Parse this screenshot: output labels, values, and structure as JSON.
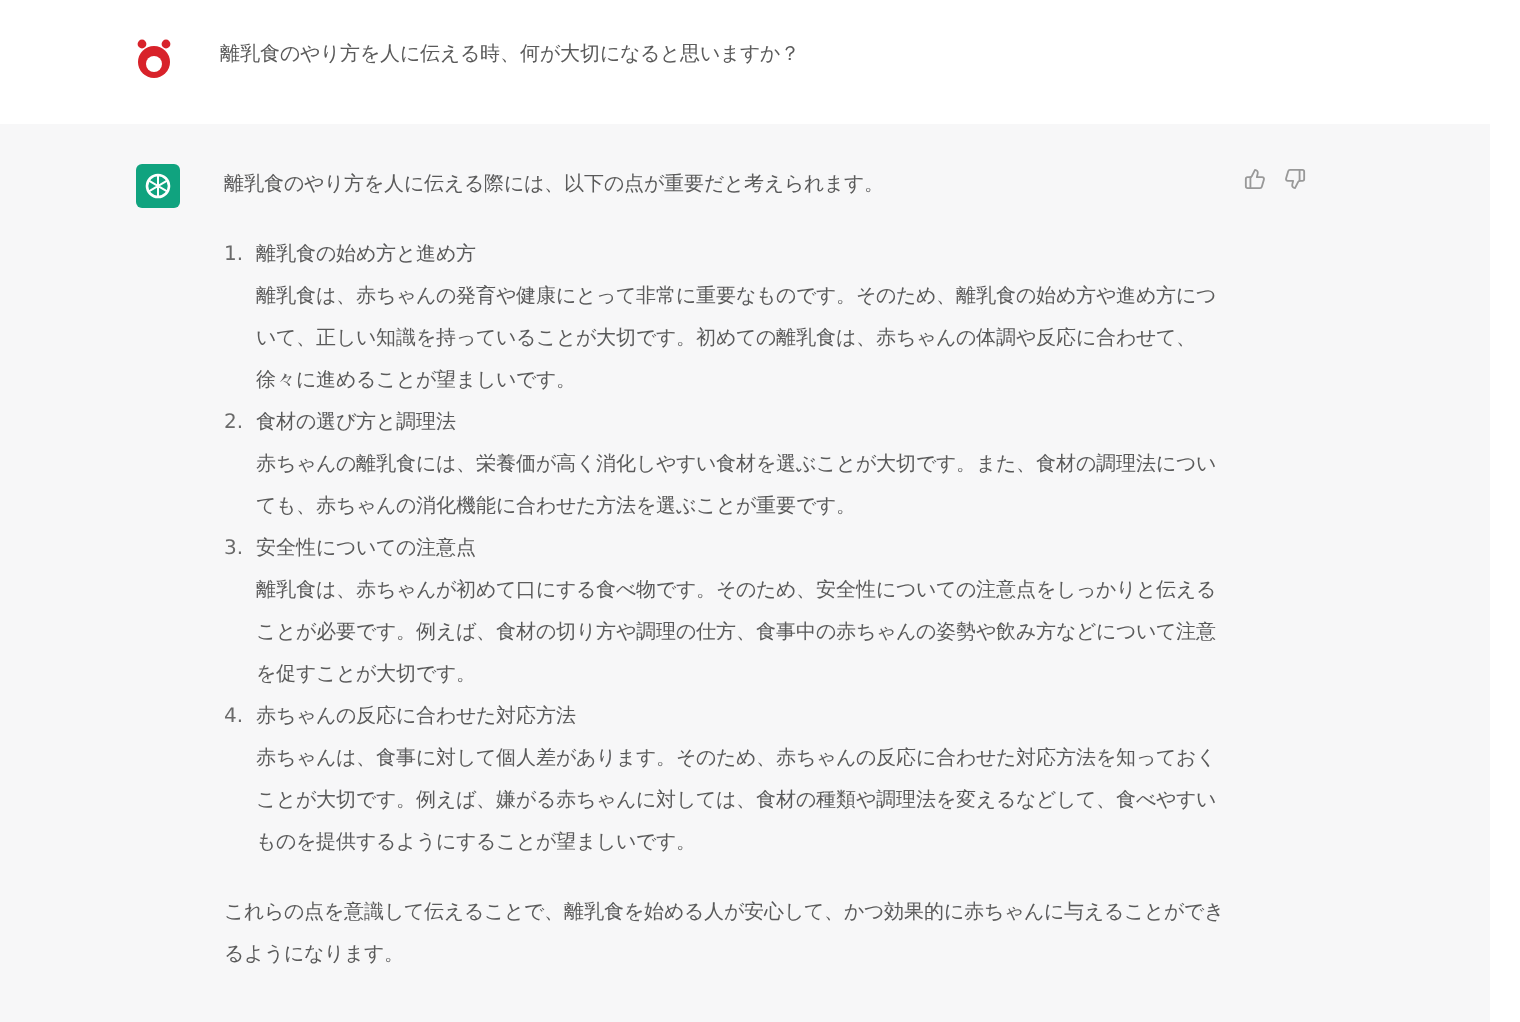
{
  "user_message": {
    "text": "離乳食のやり方を人に伝える時、何が大切になると思いますか？"
  },
  "assistant_message": {
    "intro": "離乳食のやり方を人に伝える際には、以下の点が重要だと考えられます。",
    "items": [
      {
        "number": "1.",
        "title": "離乳食の始め方と進め方",
        "body": "離乳食は、赤ちゃんの発育や健康にとって非常に重要なものです。そのため、離乳食の始め方や進め方について、正しい知識を持っていることが大切です。初めての離乳食は、赤ちゃんの体調や反応に合わせて、徐々に進めることが望ましいです。"
      },
      {
        "number": "2.",
        "title": "食材の選び方と調理法",
        "body": "赤ちゃんの離乳食には、栄養価が高く消化しやすい食材を選ぶことが大切です。また、食材の調理法についても、赤ちゃんの消化機能に合わせた方法を選ぶことが重要です。"
      },
      {
        "number": "3.",
        "title": "安全性についての注意点",
        "body": "離乳食は、赤ちゃんが初めて口にする食べ物です。そのため、安全性についての注意点をしっかりと伝えることが必要です。例えば、食材の切り方や調理の仕方、食事中の赤ちゃんの姿勢や飲み方などについて注意を促すことが大切です。"
      },
      {
        "number": "4.",
        "title": "赤ちゃんの反応に合わせた対応方法",
        "body": "赤ちゃんは、食事に対して個人差があります。そのため、赤ちゃんの反応に合わせた対応方法を知っておくことが大切です。例えば、嫌がる赤ちゃんに対しては、食材の種類や調理法を変えるなどして、食べやすいものを提供するようにすることが望ましいです。"
      }
    ],
    "conclusion": "これらの点を意識して伝えることで、離乳食を始める人が安心して、かつ効果的に赤ちゃんに与えることができるようになります。"
  }
}
